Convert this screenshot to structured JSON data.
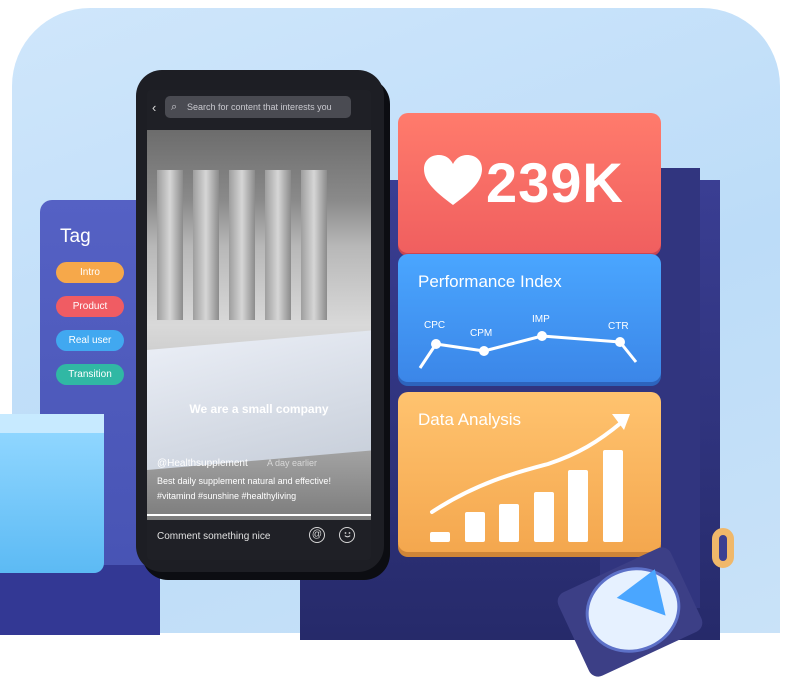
{
  "tag_panel": {
    "title": "Tag",
    "tags": [
      {
        "label": "Intro",
        "color": "#f6a84a"
      },
      {
        "label": "Product",
        "color": "#f05c63"
      },
      {
        "label": "Real user",
        "color": "#41a8f0"
      },
      {
        "label": "Transition",
        "color": "#30b8a4"
      }
    ]
  },
  "phone": {
    "search_placeholder": "Search for content that interests you",
    "video_caption": "We are a small company",
    "author_handle": "@Healthsupplement",
    "posted_time": "A day earlier",
    "description": "Best daily supplement natural and effective!",
    "hashtags": "#vitamind  #sunshine  #healthyliving",
    "comment_placeholder": "Comment something nice",
    "at_symbol": "@"
  },
  "likes_card": {
    "count": "239K",
    "icon": "heart-icon",
    "color": "#f05f5f"
  },
  "performance_card": {
    "title": "Performance Index",
    "metrics": [
      "CPC",
      "CPM",
      "IMP",
      "CTR"
    ],
    "color": "#3b86e8"
  },
  "data_card": {
    "title": "Data Analysis",
    "bars": [
      0.1,
      0.3,
      0.38,
      0.5,
      0.72,
      0.92
    ],
    "color": "#f4a74e"
  }
}
